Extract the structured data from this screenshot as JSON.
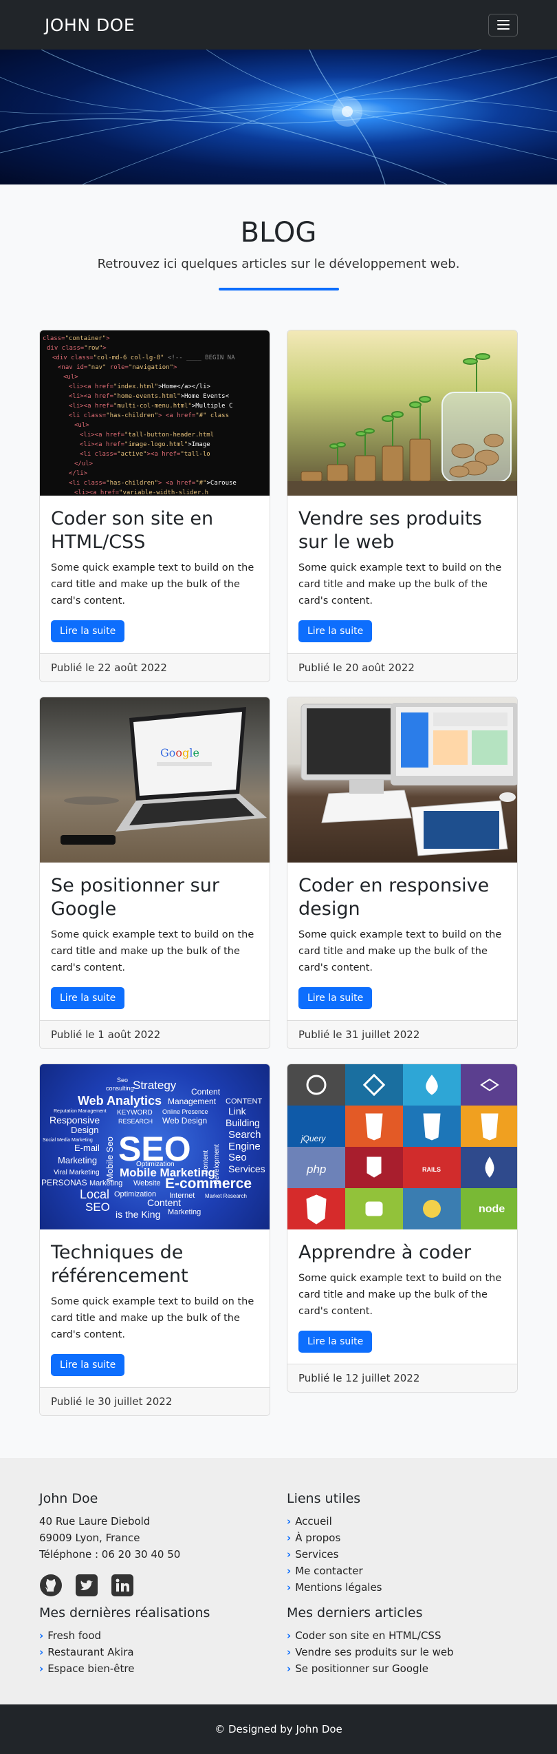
{
  "navbar": {
    "brand": "JOHN DOE",
    "menu_icon": "hamburger-icon"
  },
  "blog": {
    "title": "BLOG",
    "subtitle": "Retrouvez ici quelques articles sur le développement web."
  },
  "cards": [
    {
      "title": "Coder son site en HTML/CSS",
      "text": "Some quick example text to build on the card title and make up the bulk of the card's content.",
      "button": "Lire la suite",
      "date": "Publié le 22 août 2022",
      "image": "code-editor-image"
    },
    {
      "title": "Vendre ses produits sur le web",
      "text": "Some quick example text to build on the card title and make up the bulk of the card's content.",
      "button": "Lire la suite",
      "date": "Publié le 20 août 2022",
      "image": "coins-plants-image"
    },
    {
      "title": "Se positionner sur Google",
      "text": "Some quick example text to build on the card title and make up the bulk of the card's content.",
      "button": "Lire la suite",
      "date": "Publié le 1 août 2022",
      "image": "laptop-google-image"
    },
    {
      "title": "Coder en responsive design",
      "text": "Some quick example text to build on the card title and make up the bulk of the card's content.",
      "button": "Lire la suite",
      "date": "Publié le 31 juillet 2022",
      "image": "devices-image"
    },
    {
      "title": "Techniques de référencement",
      "text": "Some quick example text to build on the card title and make up the bulk of the card's content.",
      "button": "Lire la suite",
      "date": "Publié le 30 juillet 2022",
      "image": "seo-wordcloud-image",
      "image_words": [
        "Seo",
        "consulting",
        "Strategy",
        "Content",
        "Web Analytics",
        "Management",
        "CONTENT",
        "Reputation Management",
        "KEYWORD",
        "Online Presence",
        "Link",
        "Responsive",
        "RESEARCH",
        "Web Design",
        "Building",
        "Design",
        "Search",
        "Social Media Marketing",
        "Engine",
        "E-mail",
        "SEO",
        "Seo",
        "Marketing",
        "Mobile Seo",
        "Content",
        "Development",
        "Optimization",
        "Viral Marketing",
        "Mobile Marketing",
        "Services",
        "PERSONAS",
        "Marketing",
        "Website",
        "E-commerce",
        "Local",
        "Optimization",
        "Internet",
        "Market Research",
        "SEO",
        "Content",
        "is the King",
        "Marketing"
      ]
    },
    {
      "title": "Apprendre à coder",
      "text": "Some quick example text to build on the card title and make up the bulk of the card's content.",
      "button": "Lire la suite",
      "date": "Publié le 12 juillet 2022",
      "image": "tech-logos-image",
      "image_labels": [
        "jQuery",
        "php",
        "RAILS",
        "node"
      ]
    }
  ],
  "footer": {
    "contact": {
      "title": "John Doe",
      "address1": "40 Rue Laure Diebold",
      "address2": "69009 Lyon, France",
      "phone": "Téléphone : 06 20 30 40 50"
    },
    "social": [
      "github-icon",
      "twitter-icon",
      "linkedin-icon"
    ],
    "links": {
      "title": "Liens utiles",
      "items": [
        "Accueil",
        "À propos",
        "Services",
        "Me contacter",
        "Mentions légales"
      ]
    },
    "realisations": {
      "title": "Mes dernières réalisations",
      "items": [
        "Fresh food",
        "Restaurant Akira",
        "Espace bien-être"
      ]
    },
    "articles": {
      "title": "Mes derniers articles",
      "items": [
        "Coder son site en HTML/CSS",
        "Vendre ses produits sur le web",
        "Se positionner sur Google"
      ]
    }
  },
  "copyright": "© Designed by John Doe",
  "colors": {
    "primary": "#0d6efd",
    "dark": "#212529",
    "light": "#f8f9fa"
  }
}
